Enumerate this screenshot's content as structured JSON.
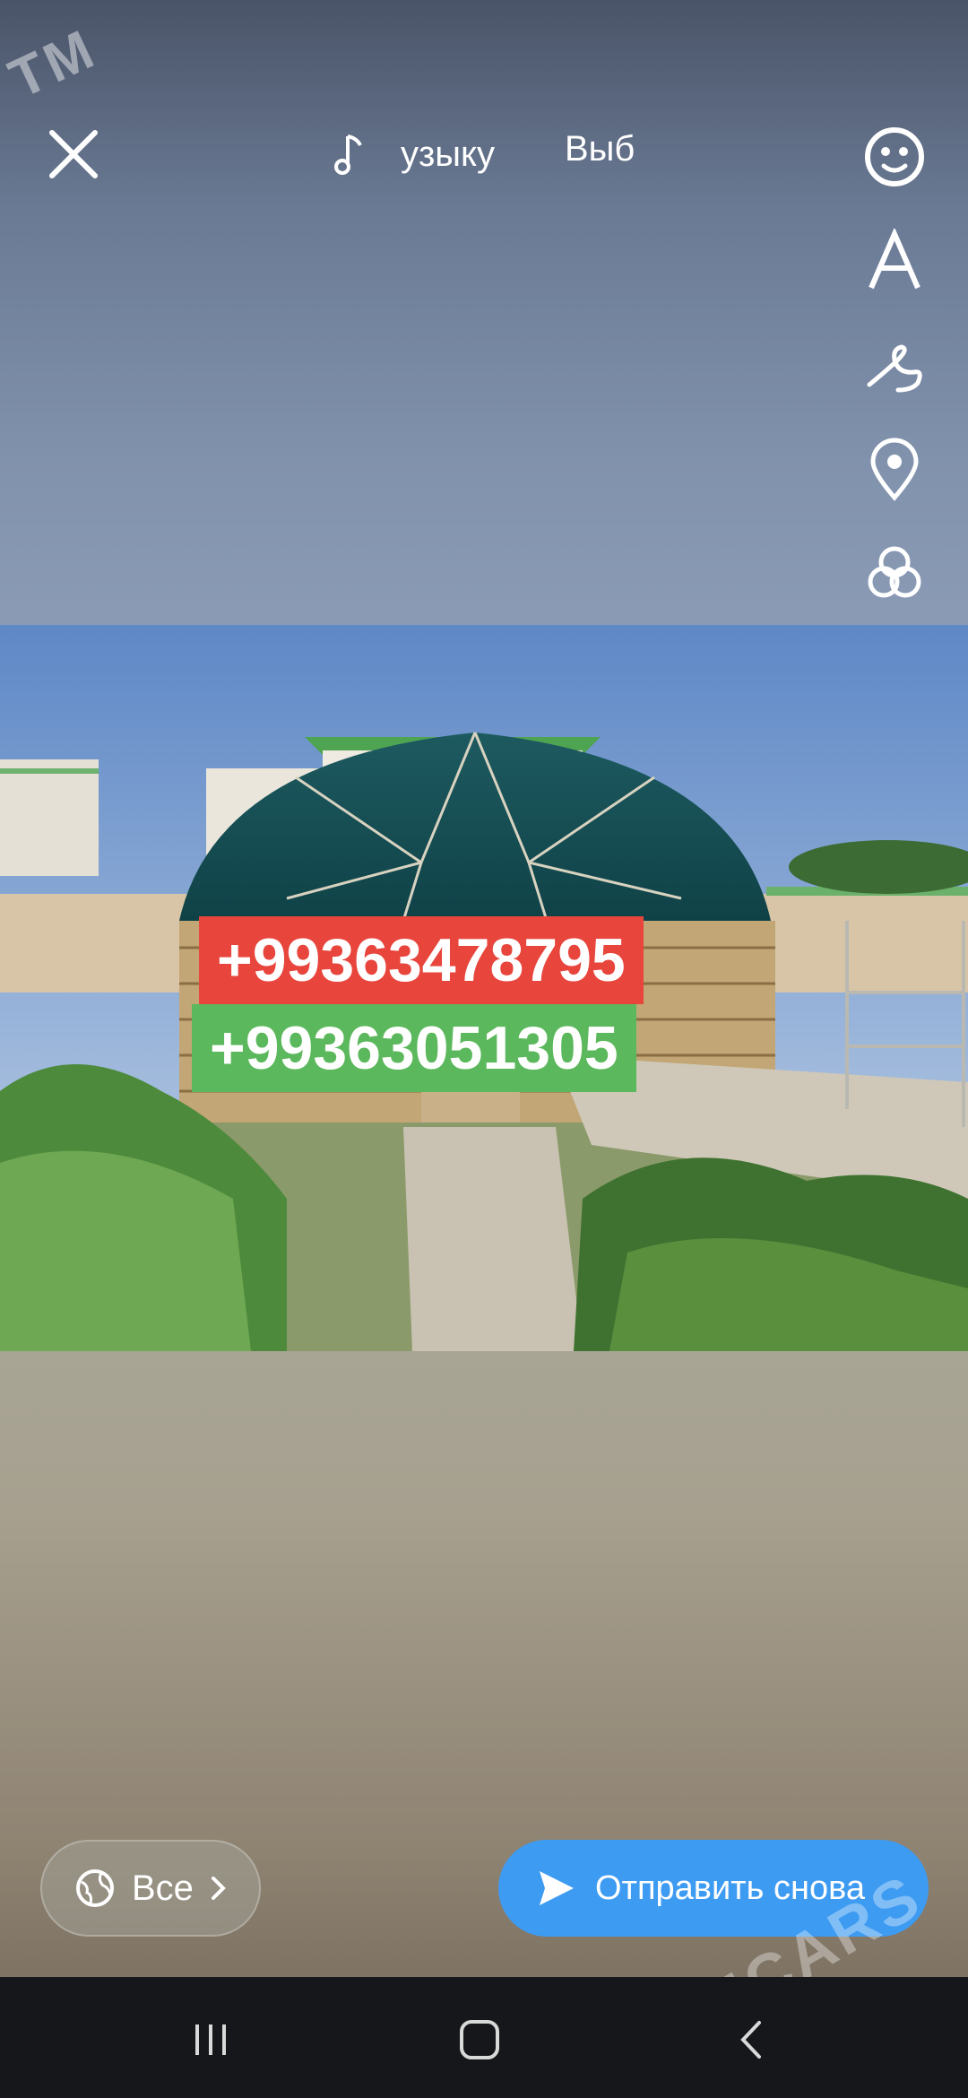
{
  "watermark": {
    "top_text": "TM",
    "bottom_text": "TMCARS"
  },
  "topbar": {
    "close_icon": "close-icon",
    "music_icon": "music-note-icon",
    "music_label": "узыку",
    "select_label": "Выб"
  },
  "sidebar": {
    "icons": [
      "sticker-icon",
      "text-icon",
      "draw-icon",
      "location-icon",
      "filter-icon",
      "mention-icon"
    ]
  },
  "photo": {
    "description_icon": "yurt-photo",
    "phones": [
      "+99363478795",
      "+99363051305"
    ],
    "colors": {
      "red": "#e8453c",
      "green": "#5cb85c"
    }
  },
  "footer": {
    "audience_label": "Все",
    "send_label": "Отправить снова",
    "send_color": "#3e9bf2"
  },
  "navbar": {
    "icons": [
      "recent-apps-icon",
      "home-icon",
      "back-icon"
    ]
  }
}
